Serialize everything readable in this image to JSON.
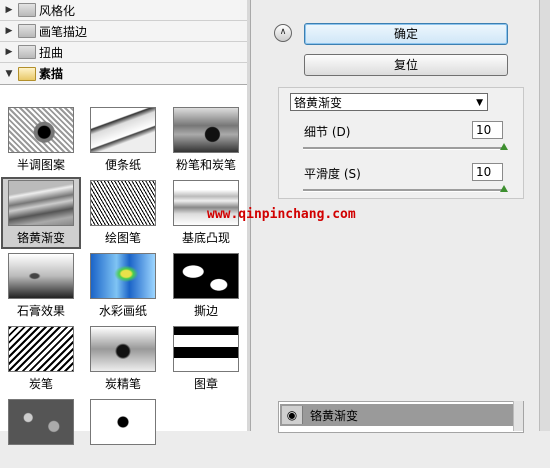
{
  "categories": [
    {
      "label": "风格化",
      "open": false
    },
    {
      "label": "画笔描边",
      "open": false
    },
    {
      "label": "扭曲",
      "open": false
    },
    {
      "label": "素描",
      "open": true
    }
  ],
  "thumbnails": [
    {
      "label": "半调图案",
      "selected": false
    },
    {
      "label": "便条纸",
      "selected": false
    },
    {
      "label": "粉笔和炭笔",
      "selected": false
    },
    {
      "label": "铬黄渐变",
      "selected": true
    },
    {
      "label": "绘图笔",
      "selected": false
    },
    {
      "label": "基底凸现",
      "selected": false
    },
    {
      "label": "石膏效果",
      "selected": false
    },
    {
      "label": "水彩画纸",
      "selected": false
    },
    {
      "label": "撕边",
      "selected": false
    },
    {
      "label": "炭笔",
      "selected": false
    },
    {
      "label": "炭精笔",
      "selected": false
    },
    {
      "label": "图章",
      "selected": false
    },
    {
      "label": "",
      "selected": false
    },
    {
      "label": "",
      "selected": false
    }
  ],
  "buttons": {
    "ok": "确定",
    "reset": "复位"
  },
  "filter_select": {
    "value": "铬黄渐变"
  },
  "params": [
    {
      "label": "细节 (D)",
      "value": "10",
      "slider_fraction": 1.0
    },
    {
      "label": "平滑度 (S)",
      "value": "10",
      "slider_fraction": 1.0
    }
  ],
  "watermark": "www.qinpinchang.com",
  "layer": {
    "name": "铬黄渐变"
  },
  "icons": {
    "collapse": "double-chevron-up-icon",
    "eye": "eye-icon",
    "folder": "folder-icon"
  },
  "colors": {
    "accent": "#3c7fb1",
    "knob": "#3d8f2f",
    "watermark": "#d10000"
  }
}
